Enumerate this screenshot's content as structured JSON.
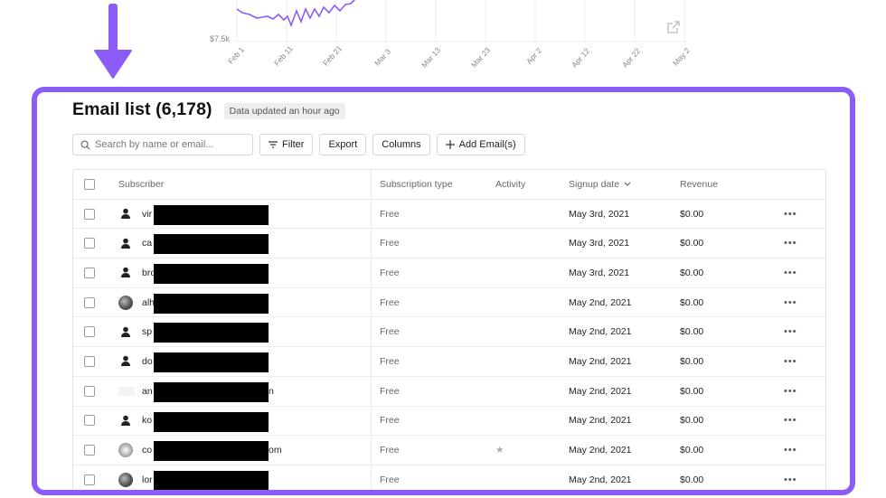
{
  "chart_fragment": {
    "y_tick": "$7.5k",
    "x_ticks": [
      "Feb 1",
      "Feb 11",
      "Feb 21",
      "Mar 3",
      "Mar 13",
      "Mar 23",
      "Apr 2",
      "Apr 12",
      "Apr 22",
      "May 2"
    ],
    "line_color": "#8b5cf6",
    "icon": "external-link-icon"
  },
  "annotation": {
    "arrow_color": "#8b5cf6",
    "panel_border_color": "#8b5cf6"
  },
  "header": {
    "title": "Email list (6,178)",
    "updated_badge": "Data updated an hour ago"
  },
  "toolbar": {
    "search_placeholder": "Search by name or email...",
    "filter_label": "Filter",
    "export_label": "Export",
    "columns_label": "Columns",
    "add_label": "Add Email(s)"
  },
  "table": {
    "columns": {
      "subscriber": "Subscriber",
      "subscription_type": "Subscription type",
      "activity": "Activity",
      "signup_date": "Signup date",
      "revenue": "Revenue"
    },
    "rows": [
      {
        "prefix": "vir",
        "tail": "",
        "avatar": "default",
        "type": "Free",
        "activity": "",
        "date": "May 3rd, 2021",
        "revenue": "$0.00"
      },
      {
        "prefix": "ca",
        "tail": "",
        "avatar": "default",
        "type": "Free",
        "activity": "",
        "date": "May 3rd, 2021",
        "revenue": "$0.00"
      },
      {
        "prefix": "bro",
        "tail": "",
        "avatar": "default",
        "type": "Free",
        "activity": "",
        "date": "May 3rd, 2021",
        "revenue": "$0.00"
      },
      {
        "prefix": "alh",
        "tail": "",
        "avatar": "photo",
        "type": "Free",
        "activity": "",
        "date": "May 2nd, 2021",
        "revenue": "$0.00"
      },
      {
        "prefix": "sp",
        "tail": "",
        "avatar": "default",
        "type": "Free",
        "activity": "",
        "date": "May 2nd, 2021",
        "revenue": "$0.00"
      },
      {
        "prefix": "do",
        "tail": "",
        "avatar": "default",
        "type": "Free",
        "activity": "",
        "date": "May 2nd, 2021",
        "revenue": "$0.00"
      },
      {
        "prefix": "an",
        "tail": "n",
        "avatar": "brand",
        "type": "Free",
        "activity": "",
        "date": "May 2nd, 2021",
        "revenue": "$0.00"
      },
      {
        "prefix": "ko",
        "tail": "",
        "avatar": "default",
        "type": "Free",
        "activity": "",
        "date": "May 2nd, 2021",
        "revenue": "$0.00"
      },
      {
        "prefix": "co",
        "tail": "om",
        "avatar": "brand2",
        "type": "Free",
        "activity": "★",
        "date": "May 2nd, 2021",
        "revenue": "$0.00"
      },
      {
        "prefix": "lor",
        "tail": "",
        "avatar": "photo",
        "type": "Free",
        "activity": "",
        "date": "May 2nd, 2021",
        "revenue": "$0.00"
      }
    ],
    "row_menu": "•••"
  }
}
